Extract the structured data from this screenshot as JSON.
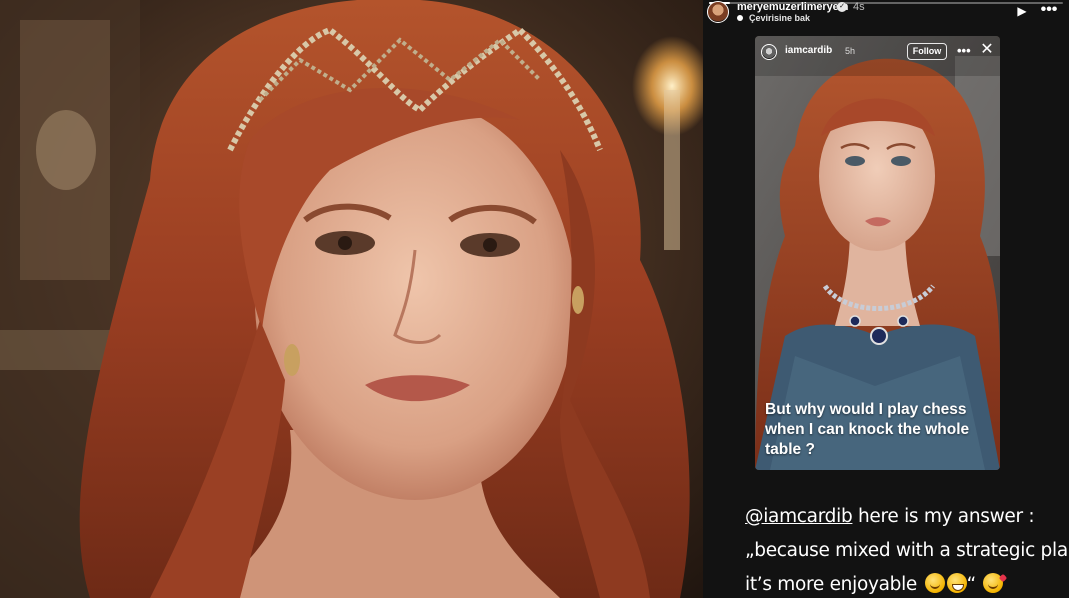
{
  "story": {
    "username": "meryemuzerlimeryem",
    "time": "4s",
    "translate_label": "Çevirisine bak",
    "play_icon": "play-icon",
    "more_icon": "more-icon"
  },
  "shared_story": {
    "username": "iamcardib",
    "time": "5h",
    "follow_label": "Follow",
    "caption": "But why would I play chess when I can knock the whole table ?"
  },
  "answer": {
    "mention": "@iamcardib",
    "line1_rest": " here is my answer :",
    "line2": "„because mixed with a strategic plan",
    "line3": "it’s more enjoyable ",
    "line3_end": "“ "
  },
  "colors": {
    "panel_bg": "#121212",
    "hair": "#a0452a",
    "skin": "#e0b49a"
  }
}
